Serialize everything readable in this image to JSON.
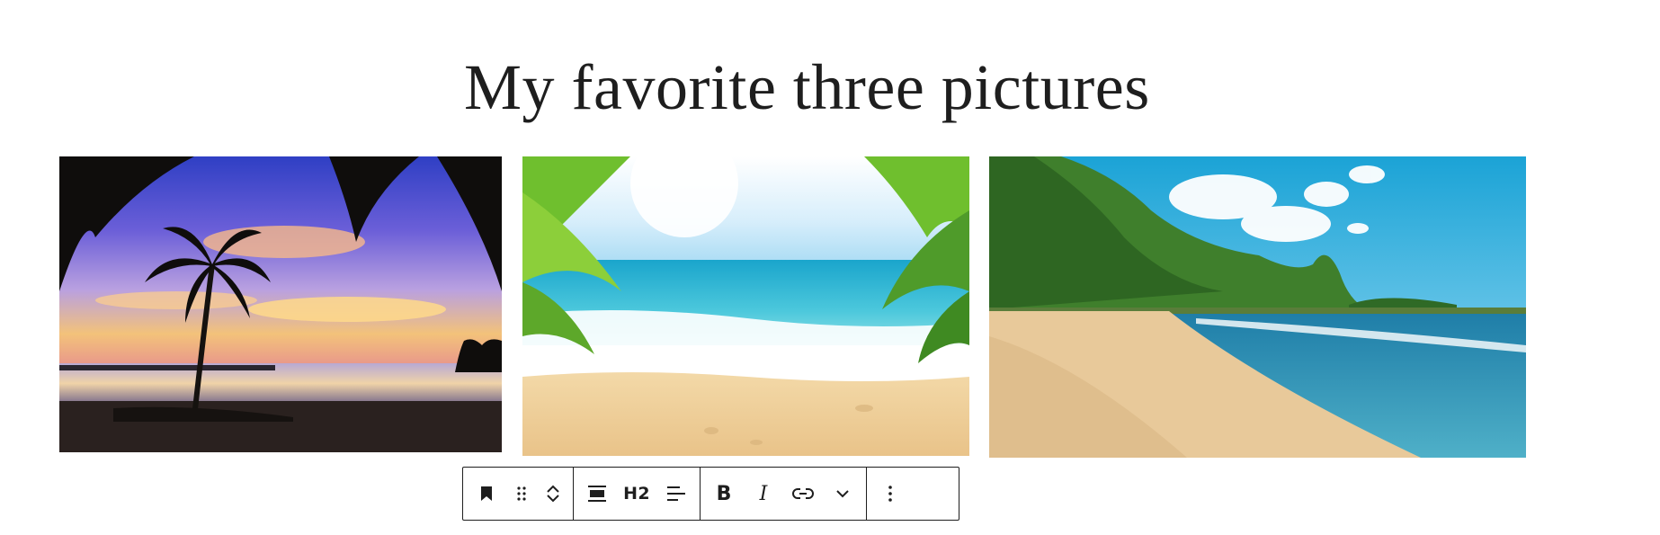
{
  "heading": {
    "text": "My favorite three pictures"
  },
  "gallery": [
    {
      "name": "Sunset beach with palm tree"
    },
    {
      "name": "Tropical beach framed by palm leaves"
    },
    {
      "name": "Beach with green mountains"
    }
  ],
  "toolbar": {
    "heading_level_label": "H2",
    "bold_label": "B",
    "italic_label": "I",
    "icons": [
      "bookmark-icon",
      "drag-handle-icon",
      "chevron-up-icon",
      "chevron-down-icon",
      "align-icon",
      "text-align-icon",
      "link-icon",
      "more-rich-text-icon",
      "more-options-icon"
    ]
  },
  "colors": {
    "text": "#1e1e1e",
    "border": "#1e1e1e",
    "background": "#ffffff"
  }
}
